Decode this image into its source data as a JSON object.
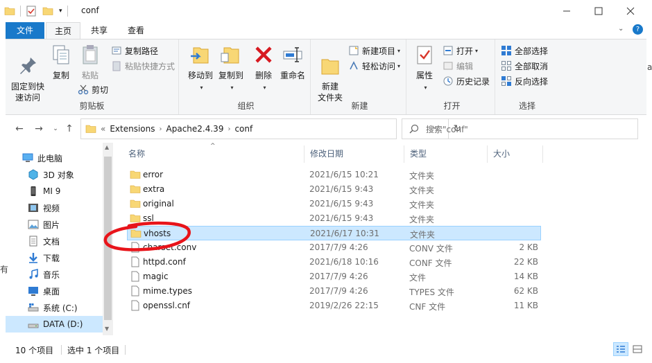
{
  "window": {
    "title": "conf",
    "controls": {
      "minimize": "minimize",
      "maximize": "maximize",
      "close": "close"
    }
  },
  "tabs": [
    {
      "label": "文件"
    },
    {
      "label": "主页"
    },
    {
      "label": "共享"
    },
    {
      "label": "查看"
    }
  ],
  "ribbon": {
    "clipboard": {
      "group_label": "剪贴板",
      "pin": "固定到快\n速访问",
      "copy": "复制",
      "paste": "粘贴",
      "copy_path": "复制路径",
      "paste_shortcut": "粘贴快捷方式",
      "cut": "剪切"
    },
    "organize": {
      "group_label": "组织",
      "move_to": "移动到",
      "copy_to": "复制到",
      "delete": "删除",
      "rename": "重命名"
    },
    "new": {
      "group_label": "新建",
      "new_folder": "新建\n文件夹",
      "new_item": "新建项目",
      "easy_access": "轻松访问"
    },
    "open": {
      "group_label": "打开",
      "properties": "属性",
      "open": "打开",
      "edit": "编辑",
      "history": "历史记录"
    },
    "select": {
      "group_label": "选择",
      "select_all": "全部选择",
      "select_none": "全部取消",
      "invert": "反向选择"
    }
  },
  "address": {
    "overflow": "«",
    "crumbs": [
      "Extensions",
      "Apache2.4.39",
      "conf"
    ]
  },
  "search": {
    "placeholder": "搜索\"conf\""
  },
  "nav": {
    "items": [
      {
        "label": "此电脑",
        "icon": "computer-icon"
      },
      {
        "label": "3D 对象",
        "icon": "3d-objects-icon"
      },
      {
        "label": "MI 9",
        "icon": "phone-icon"
      },
      {
        "label": "视频",
        "icon": "video-icon"
      },
      {
        "label": "图片",
        "icon": "pictures-icon"
      },
      {
        "label": "文档",
        "icon": "documents-icon"
      },
      {
        "label": "下载",
        "icon": "download-icon"
      },
      {
        "label": "音乐",
        "icon": "music-icon"
      },
      {
        "label": "桌面",
        "icon": "desktop-icon"
      },
      {
        "label": "系统 (C:)",
        "icon": "drive-c-icon"
      },
      {
        "label": "DATA (D:)",
        "icon": "drive-d-icon"
      }
    ]
  },
  "columns": {
    "name": "名称",
    "date": "修改日期",
    "type": "类型",
    "size": "大小"
  },
  "files": [
    {
      "name": "error",
      "date": "2021/6/15 10:21",
      "type": "文件夹",
      "size": "",
      "kind": "folder"
    },
    {
      "name": "extra",
      "date": "2021/6/15 9:43",
      "type": "文件夹",
      "size": "",
      "kind": "folder"
    },
    {
      "name": "original",
      "date": "2021/6/15 9:43",
      "type": "文件夹",
      "size": "",
      "kind": "folder"
    },
    {
      "name": "ssl",
      "date": "2021/6/15 9:43",
      "type": "文件夹",
      "size": "",
      "kind": "folder"
    },
    {
      "name": "vhosts",
      "date": "2021/6/17 10:31",
      "type": "文件夹",
      "size": "",
      "kind": "folder"
    },
    {
      "name": "charset.conv",
      "date": "2017/7/9 4:26",
      "type": "CONV 文件",
      "size": "2 KB",
      "kind": "file"
    },
    {
      "name": "httpd.conf",
      "date": "2021/6/18 10:16",
      "type": "CONF 文件",
      "size": "22 KB",
      "kind": "file"
    },
    {
      "name": "magic",
      "date": "2017/7/9 4:26",
      "type": "文件",
      "size": "14 KB",
      "kind": "file"
    },
    {
      "name": "mime.types",
      "date": "2017/7/9 4:26",
      "type": "TYPES 文件",
      "size": "62 KB",
      "kind": "file"
    },
    {
      "name": "openssl.cnf",
      "date": "2019/2/26 22:15",
      "type": "CNF 文件",
      "size": "11 KB",
      "kind": "file"
    }
  ],
  "status": {
    "count": "10 个项目",
    "selection": "选中 1 个项目"
  },
  "colors": {
    "accent": "#1979ca",
    "selection": "#cce8ff",
    "folder": "#f8d775",
    "annotation": "#e8141a"
  }
}
